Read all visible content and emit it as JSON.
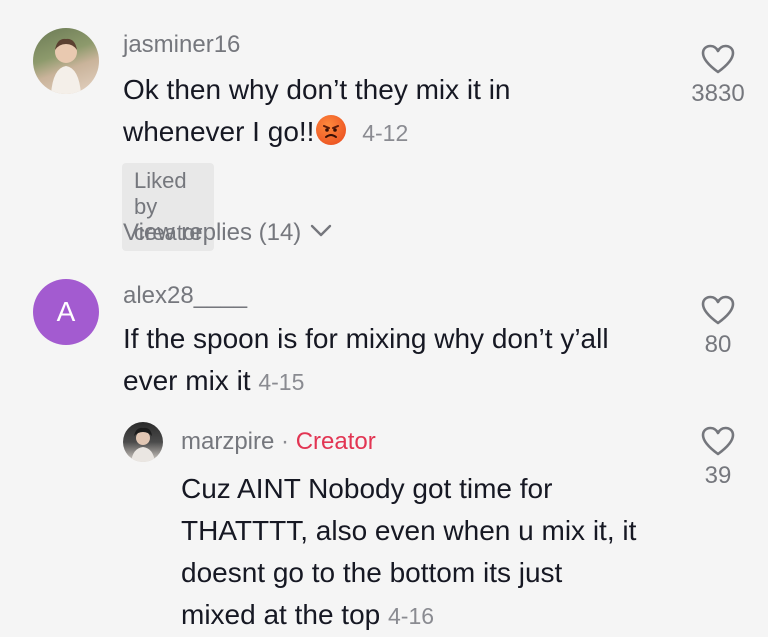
{
  "comments": [
    {
      "username": "jasminer16",
      "text_line1": "Ok then why don’t they mix it in",
      "text_line2": "whenever I go!!",
      "emoji_icon": "angry-face-emoji",
      "date": "4-12",
      "likes": "3830",
      "liked_by_creator": "Liked by creator",
      "view_replies": "View replies (14)"
    },
    {
      "username": "alex28____",
      "avatar_letter": "A",
      "avatar_color": "#a35bd0",
      "text_line1": "If the spoon is for mixing why don’t y’all",
      "text_line2": "ever mix it",
      "date": "4-15",
      "likes": "80"
    },
    {
      "username": "marzpire",
      "separator": "·",
      "badge": "Creator",
      "text_lines": [
        "Cuz AINT Nobody got time for",
        "THATTTT, also even when u mix it, it",
        "doesnt go to the bottom its just",
        "mixed at the top"
      ],
      "date": "4-16",
      "likes": "39"
    }
  ],
  "colors": {
    "background": "#f5f5f5",
    "creator_badge": "#e23553",
    "secondary_text": "#75777d"
  }
}
